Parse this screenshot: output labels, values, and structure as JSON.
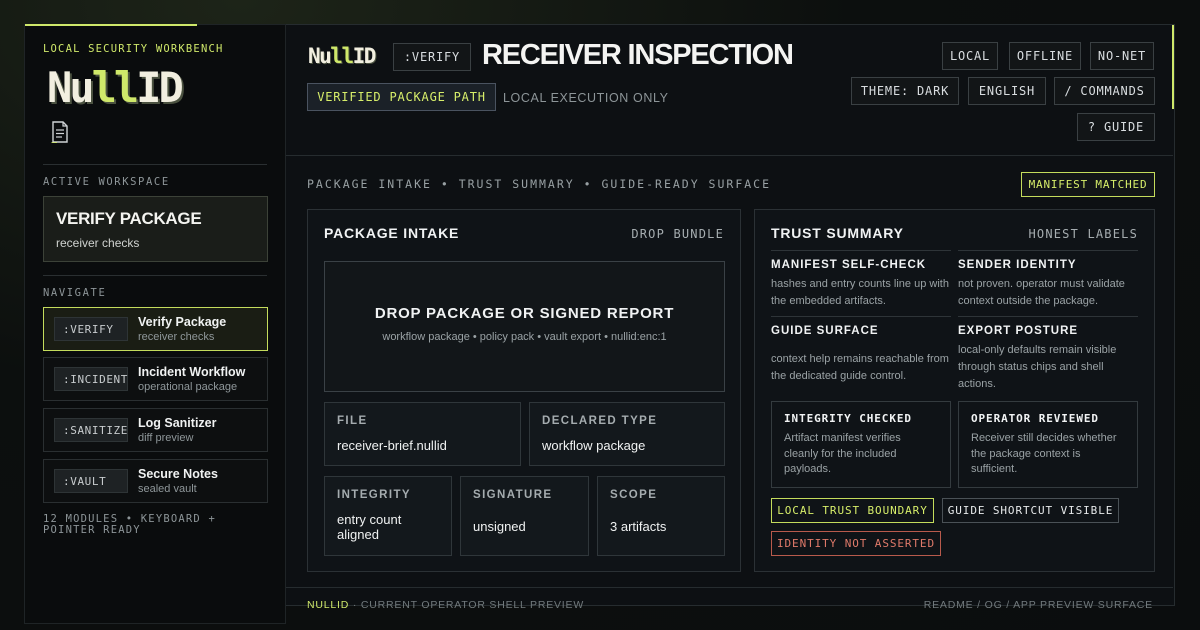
{
  "sidebar": {
    "workbench_label": "LOCAL SECURITY WORKBENCH",
    "logo": {
      "left": "Nu",
      "bars": "ll",
      "right": "ID"
    },
    "doc_icon": "document-icon",
    "active_workspace_label": "ACTIVE WORKSPACE",
    "workspace": {
      "title": "VERIFY PACKAGE",
      "subtitle": "receiver checks"
    },
    "navigate_label": "NAVIGATE",
    "items": [
      {
        "cmd": ":VERIFY",
        "name": "Verify Package",
        "desc": "receiver checks",
        "active": true
      },
      {
        "cmd": ":INCIDENT",
        "name": "Incident Workflow",
        "desc": "operational package",
        "active": false
      },
      {
        "cmd": ":SANITIZE",
        "name": "Log Sanitizer",
        "desc": "diff preview",
        "active": false
      },
      {
        "cmd": ":VAULT",
        "name": "Secure Notes",
        "desc": "sealed vault",
        "active": false
      }
    ],
    "footer": "12 MODULES • KEYBOARD + POINTER READY"
  },
  "header": {
    "logo": {
      "left": "Nu",
      "bars": "ll",
      "right": "ID"
    },
    "command": ":VERIFY",
    "title": "RECEIVER INSPECTION",
    "verified_path": "VERIFIED PACKAGE PATH",
    "local_only": "LOCAL EXECUTION ONLY",
    "status_chips": [
      "LOCAL",
      "OFFLINE",
      "NO-NET"
    ],
    "theme": "THEME: DARK",
    "language": "ENGLISH",
    "commands": "/ COMMANDS",
    "guide": "? GUIDE"
  },
  "subnav": {
    "text": "PACKAGE INTAKE • TRUST SUMMARY • GUIDE-READY SURFACE",
    "manifest_chip": "MANIFEST MATCHED"
  },
  "intake": {
    "title": "PACKAGE INTAKE",
    "action": "DROP BUNDLE",
    "drop_title": "DROP PACKAGE OR SIGNED REPORT",
    "drop_sub": "workflow package • policy pack • vault export • nullid:enc:1",
    "file": {
      "label": "FILE",
      "value": "receiver-brief.nullid"
    },
    "declared_type": {
      "label": "DECLARED TYPE",
      "value": "workflow package"
    },
    "integrity": {
      "label": "INTEGRITY",
      "value": "entry count aligned"
    },
    "signature": {
      "label": "SIGNATURE",
      "value": "unsigned"
    },
    "scope": {
      "label": "SCOPE",
      "value": "3 artifacts"
    }
  },
  "trust": {
    "title": "TRUST SUMMARY",
    "right_label": "HONEST LABELS",
    "manifest": {
      "head": "MANIFEST SELF-CHECK",
      "text": "hashes and entry counts line up with the embedded artifacts."
    },
    "sender": {
      "head": "SENDER IDENTITY",
      "text": "not proven. operator must validate context outside the package."
    },
    "guide": {
      "head": "GUIDE SURFACE",
      "text": "context help remains reachable from the dedicated guide control."
    },
    "export": {
      "head": "EXPORT POSTURE",
      "text": "local-only defaults remain visible through status chips and shell actions."
    },
    "integrity_card": {
      "title": "INTEGRITY CHECKED",
      "text": "Artifact manifest verifies cleanly for the included payloads."
    },
    "operator_card": {
      "title": "OPERATOR REVIEWED",
      "text": "Receiver still decides whether the package context is sufficient."
    },
    "tags": {
      "boundary": "LOCAL TRUST BOUNDARY",
      "shortcut": "GUIDE SHORTCUT VISIBLE",
      "identity": "IDENTITY NOT ASSERTED"
    }
  },
  "footer": {
    "brand": "NULLID",
    "left_text": " · CURRENT OPERATOR SHELL PREVIEW",
    "right_text": "README / OG / APP PREVIEW SURFACE"
  },
  "colors": {
    "accent": "#cfe86a",
    "danger": "#e07a6a",
    "background": "#0b0d0e"
  }
}
